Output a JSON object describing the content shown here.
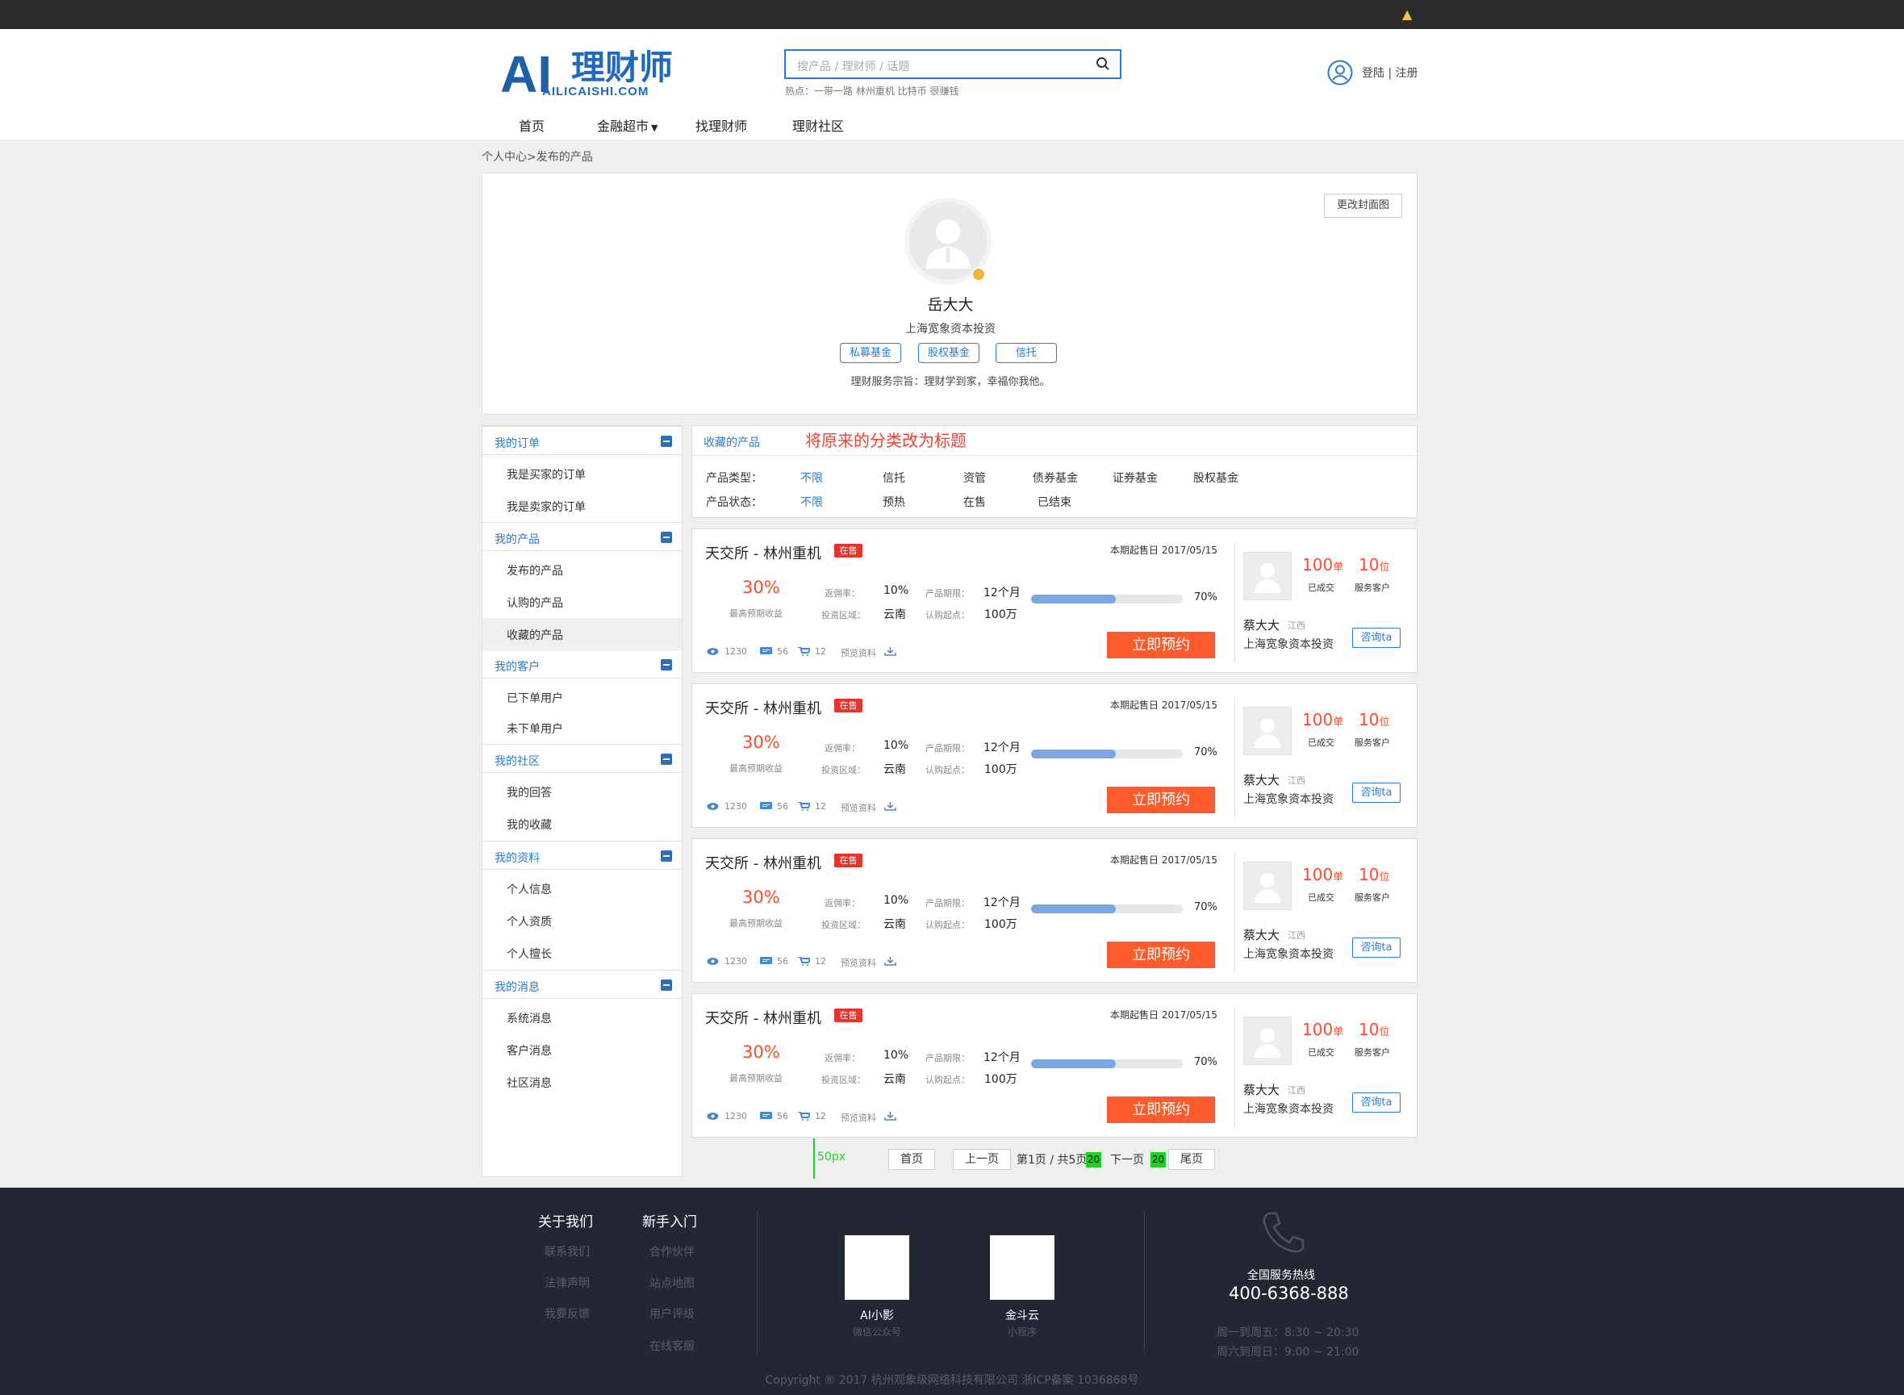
{
  "header": {
    "search_placeholder": "搜产品 / 理财师 / 话题",
    "hot": "热点：一带一路  林州重机  比特币  很赚钱",
    "login": "登陆 | 注册",
    "logo_main": "理财师",
    "logo_sub": "AILICAISHI.COM",
    "logo_badge": "AI"
  },
  "nav": [
    "首页",
    "金融超市",
    "找理财师",
    "理财社区"
  ],
  "breadcrumb": "个人中心>发布的产品",
  "profile": {
    "cover_button": "更改封面图",
    "name": "岳大大",
    "company": "上海宽象资本投资",
    "tags": [
      "私募基金",
      "股权基金",
      "信托"
    ],
    "motto": "理财服务宗旨：理财学到家，幸福你我他。"
  },
  "sidebar": [
    {
      "title": "我的订单",
      "items": [
        "我是买家的订单",
        "我是卖家的订单"
      ]
    },
    {
      "title": "我的产品",
      "items": [
        "发布的产品",
        "认购的产品",
        "收藏的产品"
      ]
    },
    {
      "title": "我的客户",
      "items": [
        "已下单用户",
        "未下单用户"
      ]
    },
    {
      "title": "我的社区",
      "items": [
        "我的回答",
        "我的收藏"
      ]
    },
    {
      "title": "我的资料",
      "items": [
        "个人信息",
        "个人资质",
        "个人擅长"
      ]
    },
    {
      "title": "我的消息",
      "items": [
        "系统消息",
        "客户消息",
        "社区消息"
      ]
    }
  ],
  "filter": {
    "title": "收藏的产品",
    "note": "将原来的分类改为标题",
    "type_label": "产品类型：",
    "types": [
      "不限",
      "信托",
      "资管",
      "债券基金",
      "证券基金",
      "股权基金"
    ],
    "status_label": "产品状态：",
    "statuses": [
      "不限",
      "预热",
      "在售",
      "已结束"
    ]
  },
  "product": {
    "title": "天交所 - 林州重机",
    "tag": "在售",
    "date": "本期起售日 2017/05/15",
    "rate": "30%",
    "rate_label": "最高预期收益",
    "rebate_label": "返佣率：",
    "rebate": "10%",
    "term_label": "产品期限：",
    "term": "12个月",
    "region_label": "投资区域：",
    "region": "云南",
    "min_label": "认购起点：",
    "min": "100万",
    "progress": 0.7,
    "progress_text": "70%",
    "button": "立即预约",
    "views": "1230",
    "comments": "56",
    "carts": "12",
    "docs": "预览资料",
    "deals": "100",
    "deals_unit": "单",
    "deals_label": "已成交",
    "clients": "10",
    "clients_unit": "位",
    "clients_label": "服务客户",
    "manager": "蔡大大",
    "manager_region": "江西",
    "manager_company": "上海宽象资本投资",
    "ask": "咨询ta"
  },
  "pager": {
    "note": "50px",
    "first": "首页",
    "prev": "上一页",
    "info": "第1页 / 共5页",
    "next": "下一页",
    "last": "尾页",
    "gap": "20"
  },
  "footer": {
    "col1": {
      "title": "关于我们",
      "links": [
        "联系我们",
        "法律声明",
        "我要反馈"
      ]
    },
    "col2": {
      "title": "新手入门",
      "links": [
        "合作伙伴",
        "站点地图",
        "用户评级",
        "在线客服"
      ]
    },
    "qr1": {
      "name": "AI小影",
      "sub": "微信公众号"
    },
    "qr2": {
      "name": "金斗云",
      "sub": "小程序"
    },
    "hotline_label": "全国服务热线",
    "hotline": "400-6368-888",
    "hours1": "周一到周五：8:30 ~ 20:30",
    "hours2": "周六到周日：9:00 ~ 21:00",
    "copyright": "Copyright ® 2017 杭州观象级网络科技有限公司 浙ICP备案 1036868号"
  },
  "colors": {
    "accent": "#2a7bd1",
    "orange": "#ff5a2c",
    "footer": "#232734"
  }
}
